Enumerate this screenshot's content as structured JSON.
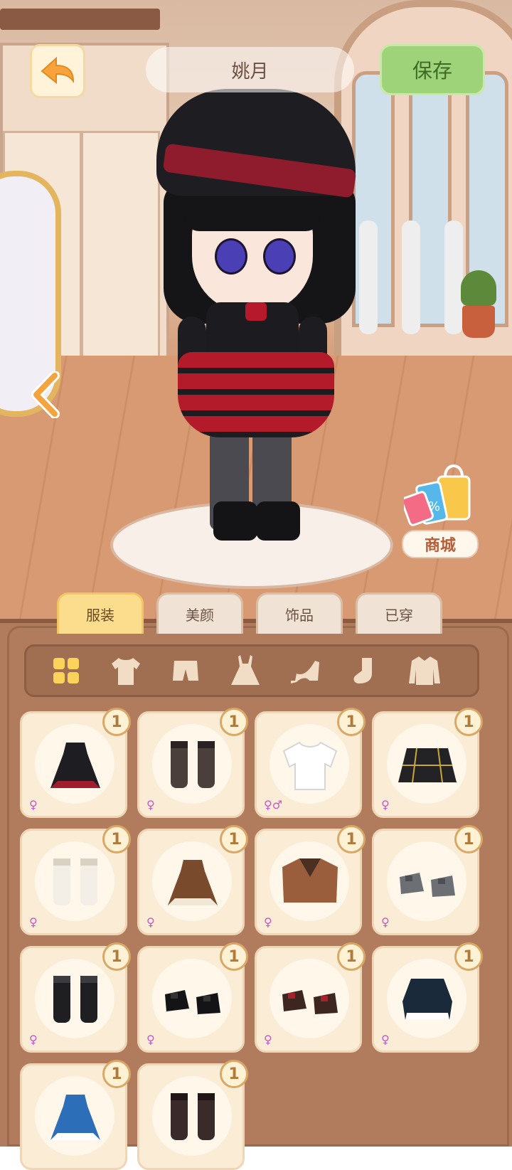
{
  "header": {
    "character_name": "姚月",
    "save_label": "保存",
    "back_icon": "back-arrow-icon"
  },
  "shop": {
    "label": "商城",
    "icon": "shopping-bag-icon"
  },
  "tabs": [
    {
      "label": "服装",
      "active": true
    },
    {
      "label": "美颜",
      "active": false
    },
    {
      "label": "饰品",
      "active": false
    },
    {
      "label": "已穿",
      "active": false
    }
  ],
  "categories": [
    {
      "name": "all",
      "icon": "grid-icon",
      "active": true
    },
    {
      "name": "top",
      "icon": "shirt-icon",
      "active": false
    },
    {
      "name": "bottom",
      "icon": "shorts-icon",
      "active": false
    },
    {
      "name": "dress",
      "icon": "dress-icon",
      "active": false
    },
    {
      "name": "shoes",
      "icon": "heel-icon",
      "active": false
    },
    {
      "name": "socks",
      "icon": "sock-icon",
      "active": false
    },
    {
      "name": "outerwear",
      "icon": "jacket-icon",
      "active": false
    }
  ],
  "items": [
    {
      "count": "1",
      "gender": "♀",
      "kind": "dress",
      "color": "#1e1e22",
      "accent": "#a11d2e"
    },
    {
      "count": "1",
      "gender": "♀",
      "kind": "socks",
      "color": "#4b3f3c",
      "accent": "#2a2222"
    },
    {
      "count": "1",
      "gender": "♀♂",
      "kind": "shirt",
      "color": "#ffffff",
      "accent": "#d6d6d6"
    },
    {
      "count": "1",
      "gender": "♀",
      "kind": "skirt",
      "color": "#232326",
      "accent": "#c9a83a"
    },
    {
      "count": "1",
      "gender": "♀",
      "kind": "socks",
      "color": "#f3efe6",
      "accent": "#d9d2c3"
    },
    {
      "count": "1",
      "gender": "♀",
      "kind": "dress",
      "color": "#7a4a2c",
      "accent": "#f1e7d7"
    },
    {
      "count": "1",
      "gender": "♀",
      "kind": "jacket",
      "color": "#9a5e3c",
      "accent": "#4a2f22"
    },
    {
      "count": "1",
      "gender": "♀",
      "kind": "shoes",
      "color": "#6c6f74",
      "accent": "#4b4e52"
    },
    {
      "count": "1",
      "gender": "♀",
      "kind": "socks",
      "color": "#1f1f22",
      "accent": "#3b3b40"
    },
    {
      "count": "1",
      "gender": "♀",
      "kind": "shoes",
      "color": "#141416",
      "accent": "#333"
    },
    {
      "count": "1",
      "gender": "♀",
      "kind": "shoes",
      "color": "#3e2620",
      "accent": "#a3222e"
    },
    {
      "count": "1",
      "gender": "♀",
      "kind": "top",
      "color": "#1b2a3a",
      "accent": "#ffffff"
    },
    {
      "count": "1",
      "gender": "",
      "kind": "dress",
      "color": "#2d6eb8",
      "accent": "#ffffff"
    },
    {
      "count": "1",
      "gender": "",
      "kind": "socks",
      "color": "#3a2a2a",
      "accent": "#221616"
    }
  ]
}
